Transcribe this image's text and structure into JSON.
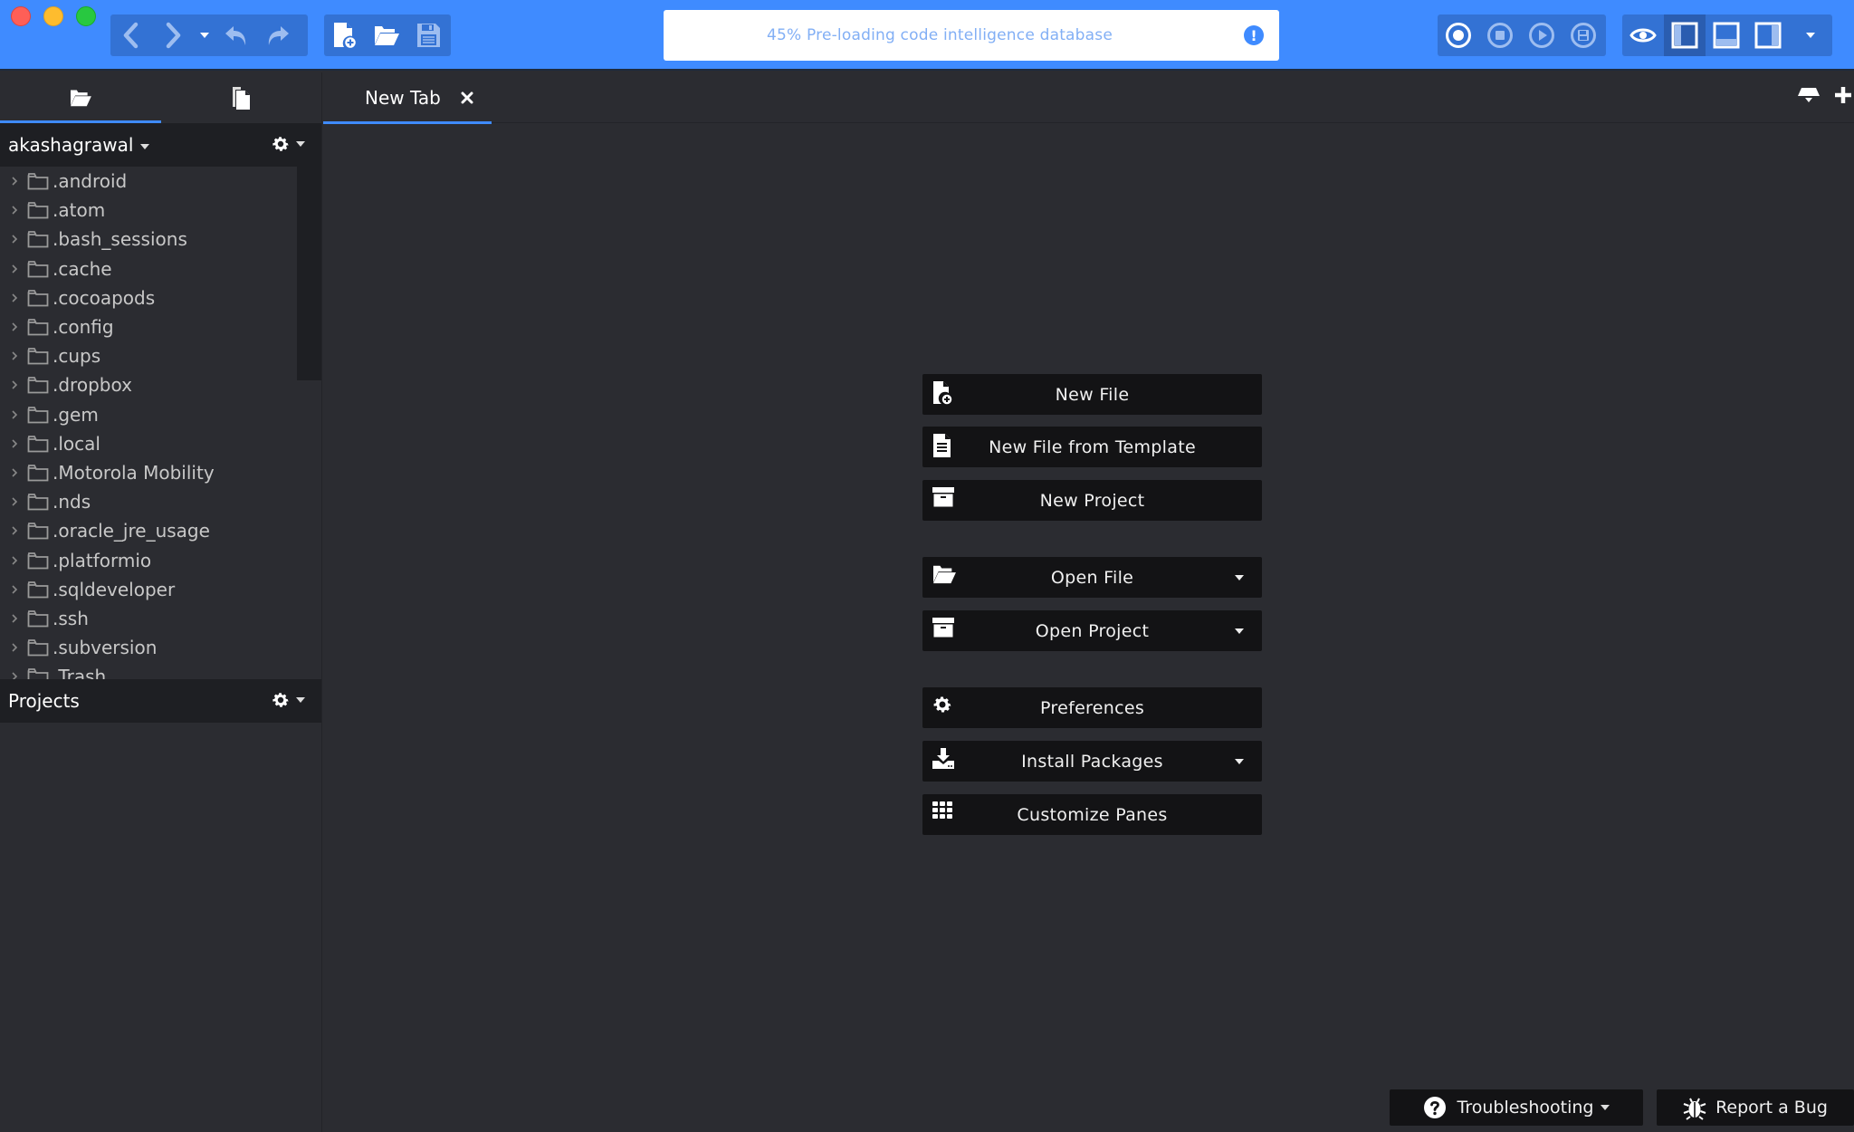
{
  "window": {
    "traffic_lights": [
      "close",
      "minimize",
      "maximize"
    ]
  },
  "toolbar": {
    "nav_icons": [
      "back-icon",
      "forward-icon",
      "history-dropdown-icon",
      "undo-icon",
      "redo-icon"
    ],
    "file_icons": [
      "new-file-icon",
      "open-folder-icon",
      "save-icon"
    ],
    "macro_icons": [
      "record-macro-icon",
      "stop-macro-icon",
      "play-macro-icon",
      "save-macro-icon"
    ],
    "view_icons": [
      "focus-mode-icon",
      "left-pane-icon",
      "bottom-pane-icon",
      "right-pane-icon",
      "view-dropdown-icon"
    ]
  },
  "status": {
    "progress_percent": 45,
    "message": "45% Pre-loading code intelligence database",
    "alert_icon": "!"
  },
  "sidebar": {
    "tabs": [
      {
        "name": "places",
        "icon": "folder-open-icon",
        "active": true
      },
      {
        "name": "open-files",
        "icon": "files-icon",
        "active": false
      }
    ],
    "places_title": "akashagrawal",
    "tree": [
      {
        "label": ".android"
      },
      {
        "label": ".atom"
      },
      {
        "label": ".bash_sessions"
      },
      {
        "label": ".cache"
      },
      {
        "label": ".cocoapods"
      },
      {
        "label": ".config"
      },
      {
        "label": ".cups"
      },
      {
        "label": ".dropbox"
      },
      {
        "label": ".gem"
      },
      {
        "label": ".local"
      },
      {
        "label": ".Motorola Mobility"
      },
      {
        "label": ".nds"
      },
      {
        "label": ".oracle_jre_usage"
      },
      {
        "label": ".platformio"
      },
      {
        "label": ".sqldeveloper"
      },
      {
        "label": ".ssh"
      },
      {
        "label": ".subversion"
      },
      {
        "label": ".Trash"
      }
    ],
    "projects_title": "Projects"
  },
  "editor": {
    "tabs": [
      {
        "label": "New Tab",
        "active": true
      }
    ]
  },
  "quick_actions": [
    {
      "label": "New File",
      "icon": "new-file-icon",
      "dropdown": false
    },
    {
      "label": "New File from Template",
      "icon": "file-template-icon",
      "dropdown": false
    },
    {
      "label": "New Project",
      "icon": "project-box-icon",
      "dropdown": false
    },
    {
      "label": "Open File",
      "icon": "folder-open-icon",
      "dropdown": true
    },
    {
      "label": "Open Project",
      "icon": "project-box-icon",
      "dropdown": true
    },
    {
      "label": "Preferences",
      "icon": "gear-icon",
      "dropdown": false
    },
    {
      "label": "Install Packages",
      "icon": "download-icon",
      "dropdown": true
    },
    {
      "label": "Customize Panes",
      "icon": "grid-icon",
      "dropdown": false
    }
  ],
  "footer": {
    "troubleshooting": "Troubleshooting",
    "report_bug": "Report a Bug"
  }
}
